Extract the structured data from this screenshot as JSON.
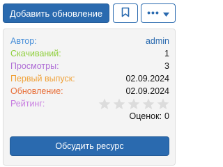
{
  "toolbar": {
    "add_update_label": "Добавить обновление",
    "bookmark_icon": "bookmark-icon",
    "more_icon": "ellipsis-icon",
    "dropdown_icon": "caret-down-icon",
    "accent_color": "#2a6aaf"
  },
  "info": {
    "rows": [
      {
        "label": "Автор:",
        "value": "admin",
        "label_color": "#4a90d9",
        "value_is_link": true
      },
      {
        "label": "Скачиваний:",
        "value": "1",
        "label_color": "#8fcf3c"
      },
      {
        "label": "Просмотры:",
        "value": "3",
        "label_color": "#b06fd6"
      },
      {
        "label": "Первый выпуск:",
        "value": "02.09.2024",
        "label_color": "#f0a23a"
      },
      {
        "label": "Обновление:",
        "value": "02.09.2024",
        "label_color": "#e8703a"
      },
      {
        "label": "Рейтинг:",
        "value": "",
        "label_color": "#c77de0"
      }
    ],
    "rating": {
      "stars_total": 5,
      "stars_filled": 0,
      "star_color_empty": "#dcdcdc"
    },
    "votes_label": "Оценок:",
    "votes_count": "0"
  },
  "discuss_button_label": "Обсудить ресурс"
}
